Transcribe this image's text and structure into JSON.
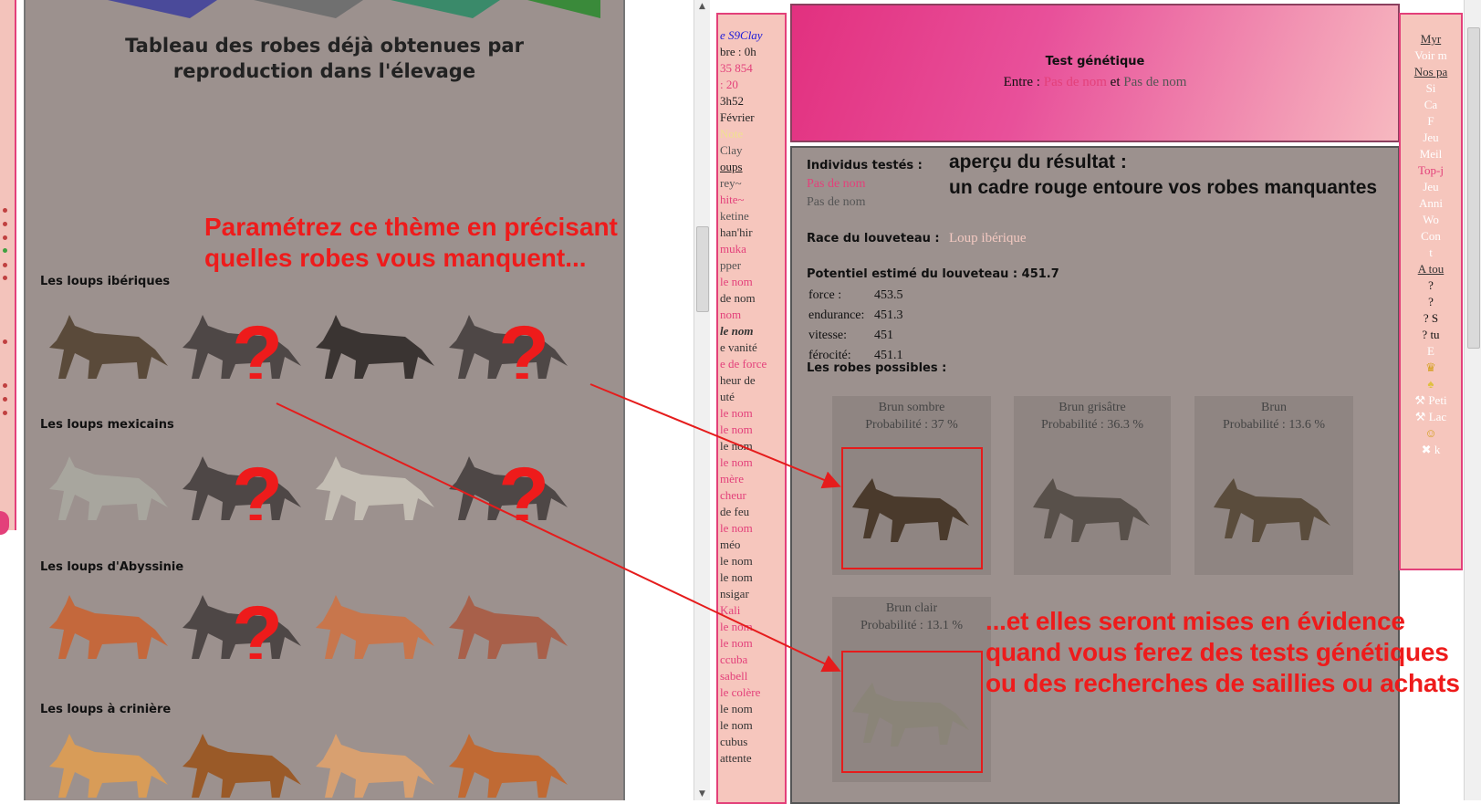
{
  "left": {
    "title_line1": "Tableau des robes déjà obtenues par",
    "title_line2": "reproduction dans l'élevage",
    "callout_line1": "Paramétrez ce thème en précisant",
    "callout_line2": "quelles robes vous manquent...",
    "sections": [
      "Les loups ibériques",
      "Les loups mexicains",
      "Les loups d'Abyssinie",
      "Les loups à crinière"
    ],
    "missing_mark": "?"
  },
  "nav": {
    "items": [
      {
        "text": "e S9Clay",
        "color": "#1a1adb",
        "italic": true
      },
      {
        "text": "bre : 0h",
        "color": "#222"
      },
      {
        "text": "35 854",
        "color": "#e3407a"
      },
      {
        "text": ": 20",
        "color": "#e3407a"
      },
      {
        "text": "3h52",
        "color": "#222"
      },
      {
        "text": "Février",
        "color": "#222"
      },
      {
        "text": "Note",
        "color": "#f0e090"
      },
      {
        "text": "",
        "color": "#222"
      },
      {
        "text": "Clay",
        "color": "#555"
      },
      {
        "text": "",
        "color": "#222"
      },
      {
        "text": "oups",
        "color": "#222",
        "underline": true
      },
      {
        "text": "rey~",
        "color": "#555"
      },
      {
        "text": "hite~",
        "color": "#e3407a"
      },
      {
        "text": "ketine",
        "color": "#555"
      },
      {
        "text": "han'hir",
        "color": "#333"
      },
      {
        "text": "muka",
        "color": "#e3407a"
      },
      {
        "text": "pper",
        "color": "#555"
      },
      {
        "text": "le nom",
        "color": "#e3407a"
      },
      {
        "text": "de nom",
        "color": "#333"
      },
      {
        "text": " nom",
        "color": "#e3407a"
      },
      {
        "text": "le nom",
        "color": "#333",
        "italic": true,
        "bold": true
      },
      {
        "text": "e vanité",
        "color": "#333"
      },
      {
        "text": "e de force",
        "color": "#e3407a"
      },
      {
        "text": "heur de",
        "color": "#333"
      },
      {
        "text": "uté",
        "color": "#333"
      },
      {
        "text": "le nom",
        "color": "#e3407a"
      },
      {
        "text": "le nom",
        "color": "#e3407a"
      },
      {
        "text": "le nom",
        "color": "#333"
      },
      {
        "text": "le nom",
        "color": "#e3407a"
      },
      {
        "text": "mère",
        "color": "#e3407a"
      },
      {
        "text": "cheur",
        "color": "#e3407a"
      },
      {
        "text": " de feu",
        "color": "#333"
      },
      {
        "text": "le nom",
        "color": "#e3407a"
      },
      {
        "text": "méo",
        "color": "#333"
      },
      {
        "text": "le nom",
        "color": "#333"
      },
      {
        "text": "le nom",
        "color": "#333"
      },
      {
        "text": "nsigar",
        "color": "#333"
      },
      {
        "text": "Kali",
        "color": "#e3407a"
      },
      {
        "text": "le nom",
        "color": "#e3407a"
      },
      {
        "text": "le nom",
        "color": "#e3407a"
      },
      {
        "text": "ccuba",
        "color": "#e3407a"
      },
      {
        "text": "sabell",
        "color": "#e3407a"
      },
      {
        "text": "le colère",
        "color": "#e3407a"
      },
      {
        "text": "le nom",
        "color": "#333"
      },
      {
        "text": "le nom",
        "color": "#333"
      },
      {
        "text": "cubus",
        "color": "#333"
      },
      {
        "text": "attente",
        "color": "#333"
      }
    ]
  },
  "header": {
    "title": "Test génétique",
    "entre_label": "Entre :",
    "parent1": "Pas de nom",
    "et": "et",
    "parent2": "Pas de nom"
  },
  "test": {
    "individus_label": "Individus testés :",
    "individu1": "Pas de nom",
    "individu2": "Pas de nom",
    "race_label": "Race du louveteau :",
    "race_value": "Loup ibérique",
    "potentiel_label": "Potentiel estimé du louveteau : 451.7",
    "stats": [
      {
        "label": "force :",
        "value": "453.5"
      },
      {
        "label": "endurance:",
        "value": "451.3"
      },
      {
        "label": "vitesse:",
        "value": "451"
      },
      {
        "label": "férocité:",
        "value": "451.1"
      }
    ],
    "robes_label": "Les robes possibles :",
    "robes": [
      {
        "name": "Brun sombre",
        "prob": "Probabilité : 37 %"
      },
      {
        "name": "Brun grisâtre",
        "prob": "Probabilité : 36.3 %"
      },
      {
        "name": "Brun",
        "prob": "Probabilité : 13.6 %"
      },
      {
        "name": "Brun clair",
        "prob": "Probabilité : 13.1 %"
      }
    ]
  },
  "overlay": {
    "result_line1": "aperçu du résultat :",
    "result_line2": "un cadre rouge entoure vos robes manquantes",
    "bottom_line1": "...et elles seront mises en évidence",
    "bottom_line2": "quand vous ferez des tests génétiques",
    "bottom_line3": "ou des recherches de saillies ou achats"
  },
  "right": {
    "items": [
      {
        "text": "Myr",
        "color": "#333",
        "underline": true
      },
      {
        "text": "Voir m",
        "color": "#fff"
      },
      {
        "text": "",
        "color": "#333"
      },
      {
        "text": "Nos pa",
        "color": "#333",
        "underline": true
      },
      {
        "text": "Si",
        "color": "#fff"
      },
      {
        "text": "Ca",
        "color": "#fff"
      },
      {
        "text": "F",
        "color": "#fff"
      },
      {
        "text": "Jeu",
        "color": "#fff"
      },
      {
        "text": "Meil",
        "color": "#fff"
      },
      {
        "text": "Top-j",
        "color": "#e3407a"
      },
      {
        "text": "Jeu",
        "color": "#fff"
      },
      {
        "text": "Anni",
        "color": "#fff"
      },
      {
        "text": "Wo",
        "color": "#fff"
      },
      {
        "text": "",
        "color": "#333"
      },
      {
        "text": "Con",
        "color": "#fff"
      },
      {
        "text": "t",
        "color": "#fff"
      },
      {
        "text": "",
        "color": "#333"
      },
      {
        "text": "A tou",
        "color": "#333",
        "underline": true
      },
      {
        "text": "?",
        "color": "#111"
      },
      {
        "text": "?",
        "color": "#111"
      },
      {
        "text": "? S",
        "color": "#111"
      },
      {
        "text": "? tu",
        "color": "#111"
      },
      {
        "text": "",
        "color": "#333"
      },
      {
        "text": "E",
        "color": "#fff"
      },
      {
        "text": "♛",
        "color": "#d4a020"
      },
      {
        "text": "♠",
        "color": "#e0c040"
      },
      {
        "text": "⚒ Peti",
        "color": "#fff"
      },
      {
        "text": "⚒ Lac",
        "color": "#fff"
      },
      {
        "text": "☺",
        "color": "#d4a020"
      },
      {
        "text": "✖ k",
        "color": "#fff"
      }
    ]
  },
  "colors": {
    "accent_pink": "#e3407a",
    "panel_gray": "#9c918e",
    "callout_red": "#ee1b1b"
  }
}
